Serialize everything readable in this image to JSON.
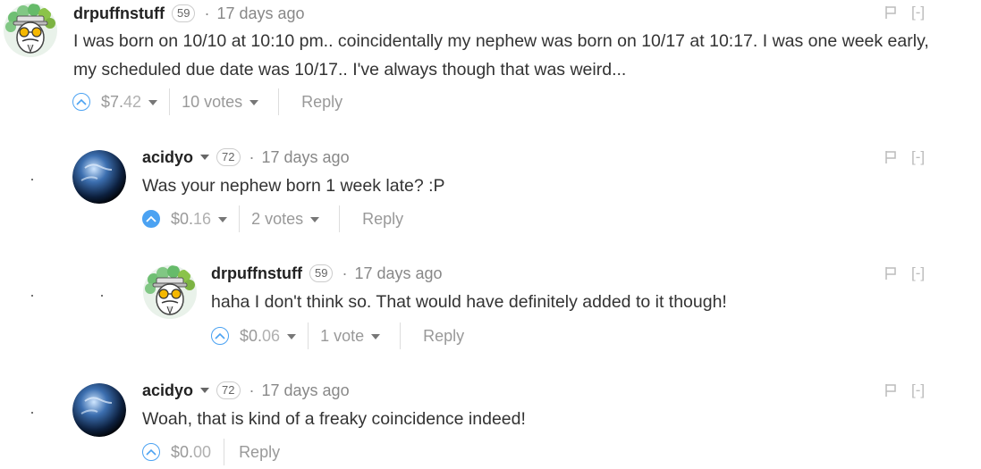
{
  "comments": [
    {
      "author": "drpuffnstuff",
      "reputation": "59",
      "time": "17 days ago",
      "dot": "·",
      "text_lines": [
        "I was born on 10/10 at 10:10 pm.. coincidentally my nephew was born on 10/17 at 10:17. I was one week early,",
        "my scheduled due date was 10/17.. I've always though that was weird..."
      ],
      "payout_main": "$7.",
      "payout_cents": "42",
      "votes": "10 votes",
      "reply": "Reply",
      "collapse": "[-]",
      "avatar": "masked-guy",
      "upvoted": false
    },
    {
      "author": "acidyo",
      "reputation": "72",
      "time": "17 days ago",
      "dot": "·",
      "text_lines": [
        "Was your nephew born 1 week late? :P"
      ],
      "payout_main": "$0.",
      "payout_cents": "16",
      "votes": "2 votes",
      "reply": "Reply",
      "collapse": "[-]",
      "avatar": "earth",
      "upvoted": true
    },
    {
      "author": "drpuffnstuff",
      "reputation": "59",
      "time": "17 days ago",
      "dot": "·",
      "text_lines": [
        "haha I don't think so. That would have definitely added to it though!"
      ],
      "payout_main": "$0.",
      "payout_cents": "06",
      "votes": "1 vote",
      "reply": "Reply",
      "collapse": "[-]",
      "avatar": "masked-guy",
      "upvoted": false
    },
    {
      "author": "acidyo",
      "reputation": "72",
      "time": "17 days ago",
      "dot": "·",
      "text_lines": [
        "Woah, that is kind of a freaky coincidence indeed!"
      ],
      "payout_main": "$0.",
      "payout_cents": "00",
      "votes": "",
      "reply": "Reply",
      "collapse": "[-]",
      "avatar": "earth",
      "upvoted": false
    }
  ],
  "colors": {
    "accent": "#4ba2f2",
    "text": "#333333",
    "muted": "#999999"
  }
}
